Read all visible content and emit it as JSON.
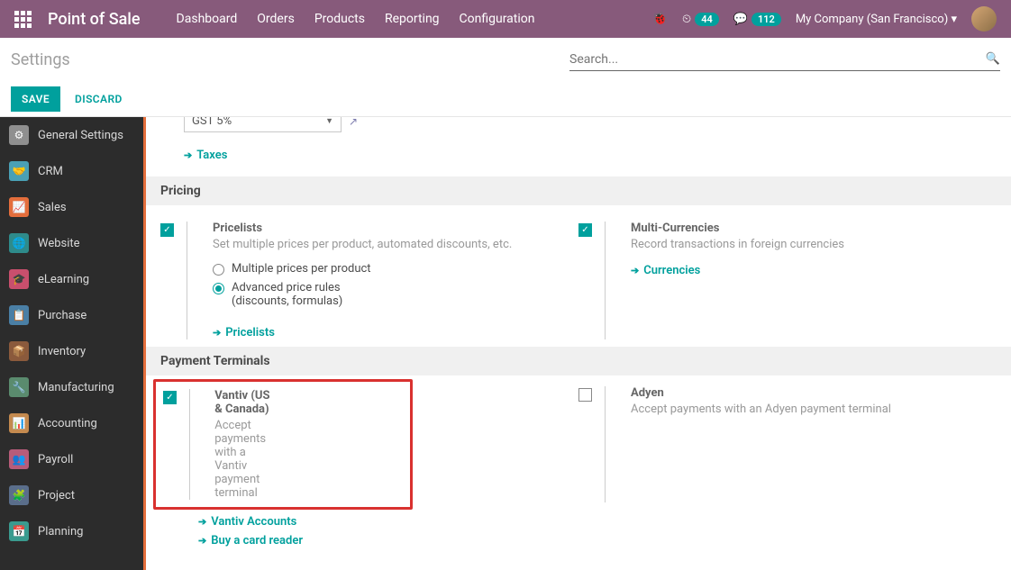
{
  "topbar": {
    "brand": "Point of Sale",
    "menu": [
      "Dashboard",
      "Orders",
      "Products",
      "Reporting",
      "Configuration"
    ],
    "badge1": "44",
    "badge2": "112",
    "company": "My Company (San Francisco)"
  },
  "page": {
    "title": "Settings",
    "search_ph": "Search..."
  },
  "actions": {
    "save": "SAVE",
    "discard": "DISCARD"
  },
  "sidebar": [
    {
      "label": "General Settings",
      "bg": "#8f8f8f",
      "g": "⚙"
    },
    {
      "label": "CRM",
      "bg": "#4aa0b5",
      "g": "🤝"
    },
    {
      "label": "Sales",
      "bg": "#e46e3c",
      "g": "📈"
    },
    {
      "label": "Website",
      "bg": "#2e8b8b",
      "g": "🌐"
    },
    {
      "label": "eLearning",
      "bg": "#c94f6d",
      "g": "🎓"
    },
    {
      "label": "Purchase",
      "bg": "#4a7fa5",
      "g": "📋"
    },
    {
      "label": "Inventory",
      "bg": "#8b5a3c",
      "g": "📦"
    },
    {
      "label": "Manufacturing",
      "bg": "#5a8b6e",
      "g": "🔧"
    },
    {
      "label": "Accounting",
      "bg": "#c48a4f",
      "g": "📊"
    },
    {
      "label": "Payroll",
      "bg": "#b85c7a",
      "g": "👥"
    },
    {
      "label": "Project",
      "bg": "#5a6e8b",
      "g": "🧩"
    },
    {
      "label": "Planning",
      "bg": "#3a9b8f",
      "g": "📅"
    }
  ],
  "tax_select": "GST 5%",
  "links": {
    "taxes": "Taxes",
    "pricelists": "Pricelists",
    "currencies": "Currencies",
    "vantiv": "Vantiv Accounts",
    "card": "Buy a card reader"
  },
  "pricing": {
    "title": "Pricing",
    "pricelists": {
      "lbl": "Pricelists",
      "desc": "Set multiple prices per product, automated discounts, etc.",
      "opt1": "Multiple prices per product",
      "opt2a": "Advanced price rules",
      "opt2b": "(discounts, formulas)"
    },
    "multi": {
      "lbl": "Multi-Currencies",
      "desc": "Record transactions in foreign currencies"
    }
  },
  "terminals": {
    "title": "Payment Terminals",
    "vantiv": {
      "lbl": "Vantiv (US & Canada)",
      "desc": "Accept payments with a Vantiv payment terminal"
    },
    "adyen": {
      "lbl": "Adyen",
      "desc": "Accept payments with an Adyen payment terminal"
    }
  }
}
